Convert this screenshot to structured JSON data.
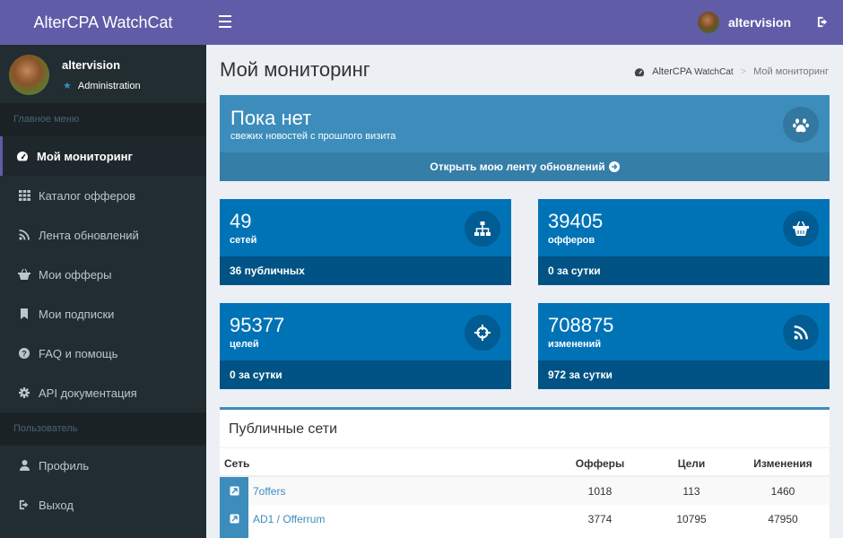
{
  "app": {
    "logo_text": "AlterCPA WatchCat"
  },
  "topbar": {
    "username": "altervision"
  },
  "sidebar": {
    "user": {
      "name": "altervision",
      "role": "Administration"
    },
    "header_main": "Главное меню",
    "header_user": "Пользователь",
    "items": [
      {
        "label": "Мой мониторинг",
        "icon": "dashboard-icon"
      },
      {
        "label": "Каталог офферов",
        "icon": "grid-icon"
      },
      {
        "label": "Лента обновлений",
        "icon": "rss-icon"
      },
      {
        "label": "Мои офферы",
        "icon": "basket-icon"
      },
      {
        "label": "Мои подписки",
        "icon": "bookmark-icon"
      },
      {
        "label": "FAQ и помощь",
        "icon": "question-icon"
      },
      {
        "label": "API документация",
        "icon": "gear-icon"
      }
    ],
    "user_items": [
      {
        "label": "Профиль",
        "icon": "user-icon"
      },
      {
        "label": "Выход",
        "icon": "logout-icon"
      }
    ]
  },
  "page": {
    "title": "Мой мониторинг",
    "breadcrumb": {
      "home_a": "AlterCPA",
      "home_b": "WatchCat",
      "separator": ">",
      "current": "Мой мониторинг"
    }
  },
  "news": {
    "title": "Пока нет",
    "subtitle": "свежих новостей с прошлого визита",
    "footer": "Открыть мою ленту обновлений"
  },
  "stats": [
    {
      "value": "49",
      "label": "сетей",
      "footer": "36 публичных",
      "icon": "sitemap-icon"
    },
    {
      "value": "39405",
      "label": "офферов",
      "footer": "0 за сутки",
      "icon": "basket-icon"
    },
    {
      "value": "95377",
      "label": "целей",
      "footer": "0 за сутки",
      "icon": "crosshairs-icon"
    },
    {
      "value": "708875",
      "label": "изменений",
      "footer": "972 за сутки",
      "icon": "rss-icon"
    }
  ],
  "networks": {
    "title": "Публичные сети",
    "columns": {
      "name": "Сеть",
      "offers": "Офферы",
      "goals": "Цели",
      "changes": "Изменения"
    },
    "rows": [
      {
        "name": "7offers",
        "offers": "1018",
        "goals": "113",
        "changes": "1460"
      },
      {
        "name": "AD1 / Offerrum",
        "offers": "3774",
        "goals": "10795",
        "changes": "47950"
      }
    ]
  },
  "colors": {
    "purple": "#605ca8",
    "sidebar": "#222d32",
    "light_blue": "#3c8dbc",
    "blue": "#0073b7",
    "blue_dark": "#005384",
    "content_bg": "#ecf0f5"
  }
}
